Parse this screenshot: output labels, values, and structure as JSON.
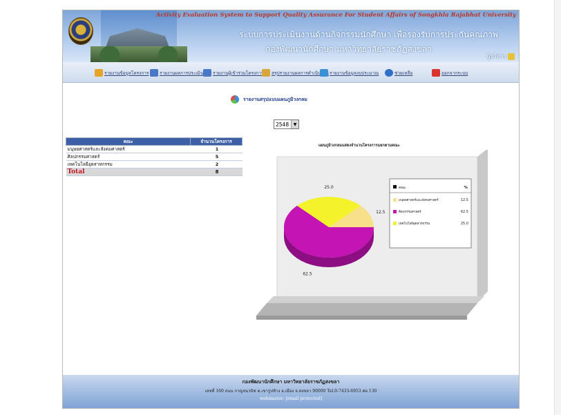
{
  "header": {
    "english_title": "Activity Evaluation System to Support Quality Assurance For Student Affairs of Songkhla Rajabhat University",
    "thai_title_line1": "ระบบการประเมินงานด้านกิจกรรมนักศึกษา  เพื่อรองรับการประกันคุณภาพ",
    "thai_title_line2": "กองพัฒนานักศึกษา  มหาวิทยาลัยราชภัฏสงขลา",
    "admin_label": "ผู้บริหาร"
  },
  "nav": [
    {
      "label": "รายงานข้อมูลโครงการ",
      "icon": "report-icon",
      "color": "#e5a42a"
    },
    {
      "label": "รายงานผลการประเมิน",
      "icon": "evaluation-icon",
      "color": "#4a78c8"
    },
    {
      "label": "รายงานผู้เข้าร่วมโครงการ",
      "icon": "participants-icon",
      "color": "#4a78c8"
    },
    {
      "label": "สรุปรายงานผลการดำเนินงาน",
      "icon": "summary-icon",
      "color": "#d9a63a"
    },
    {
      "label": "รายงานข้อมูลงบประมาณ",
      "icon": "budget-icon",
      "color": "#3b8fd6"
    },
    {
      "label": "ช่วยเหลือ",
      "icon": "help-icon",
      "color": "#2f6fc8"
    },
    {
      "label": "ออกจากระบบ",
      "icon": "logout-icon",
      "color": "#d9342b"
    }
  ],
  "report": {
    "title": "รายงานสรุปแบบแผนภูมิวงกลม",
    "year_selected": "2548"
  },
  "table": {
    "headers": [
      "คณะ",
      "จำนวนโครงการ"
    ],
    "rows": [
      {
        "faculty": "มนุษยศาสตร์และสังคมศาสตร์",
        "count": "1"
      },
      {
        "faculty": "ศิลปกรรมศาสตร์",
        "count": "5"
      },
      {
        "faculty": "เทคโนโลยีอุตสาหกรรม",
        "count": "2"
      }
    ],
    "total_label": "Total",
    "total_value": "8"
  },
  "chart_data": {
    "type": "pie",
    "title": "แผนภูมิวงกลมแสดงจำนวนโครงการแยกตามคณะ",
    "legend_header": [
      "คณะ",
      "%"
    ],
    "legend_position": "right",
    "slices": [
      {
        "label": "มนุษยศาสตร์และสังคมศาสตร์",
        "value": 12.5,
        "color": "#f8e08a"
      },
      {
        "label": "ศิลปกรรมศาสตร์",
        "value": 62.5,
        "color": "#c414b4"
      },
      {
        "label": "เทคโนโลยีอุตสาหกรรม",
        "value": 25.0,
        "color": "#f4f22a"
      }
    ]
  },
  "footer": {
    "line1": "กองพัฒนานักศึกษา มหาวิทยาลัยราชภัฏสงขลา",
    "line2": "เลขที่ 160 ถนน กาญจนวนิช ต.เขารูปช้าง อ.เมือง จ.สงขลา 90000 Tel.0-7433-6953 ต่อ 130",
    "line3": "webmaster: [email protected]"
  }
}
